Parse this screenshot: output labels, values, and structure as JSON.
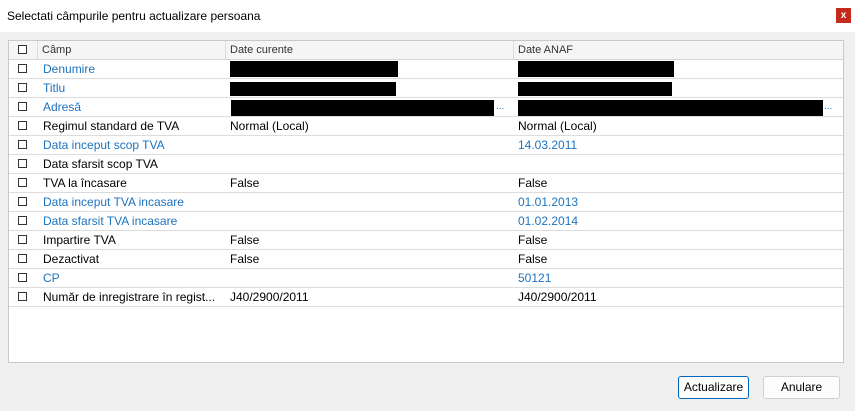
{
  "window": {
    "title": "Selectati câmpurile pentru actualizare persoana",
    "close_label": "x"
  },
  "grid": {
    "columns": [
      "Câmp",
      "Date curente",
      "Date ANAF"
    ],
    "rows": [
      {
        "field": "Denumire",
        "current": "",
        "anaf": "",
        "highlight": true
      },
      {
        "field": "Titlu",
        "current": "",
        "anaf": "",
        "highlight": true
      },
      {
        "field": "Adresă",
        "current": "",
        "anaf": "",
        "highlight": true
      },
      {
        "field": "Regimul standard de TVA",
        "current": "Normal (Local)",
        "anaf": "Normal (Local)",
        "highlight": false
      },
      {
        "field": "Data inceput scop TVA",
        "current": "",
        "anaf": "14.03.2011",
        "highlight": true
      },
      {
        "field": "Data sfarsit scop TVA",
        "current": "",
        "anaf": "",
        "highlight": false
      },
      {
        "field": "TVA la încasare",
        "current": "False",
        "anaf": "False",
        "highlight": false
      },
      {
        "field": "Data inceput TVA incasare",
        "current": "",
        "anaf": "01.01.2013",
        "highlight": true
      },
      {
        "field": "Data sfarsit TVA incasare",
        "current": "",
        "anaf": "01.02.2014",
        "highlight": true
      },
      {
        "field": "Impartire TVA",
        "current": "False",
        "anaf": "False",
        "highlight": false
      },
      {
        "field": "Dezactivat",
        "current": "False",
        "anaf": "False",
        "highlight": false
      },
      {
        "field": "CP",
        "current": "",
        "anaf": "50121",
        "highlight": true
      },
      {
        "field": "Număr de inregistrare în regist...",
        "current": "J40/2900/2011",
        "anaf": "J40/2900/2011",
        "highlight": false
      }
    ]
  },
  "buttons": {
    "update": "Actualizare",
    "cancel": "Anulare"
  },
  "colors": {
    "link": "#1e73be",
    "close_bg": "#c42b1c",
    "primary_border": "#0067c0"
  }
}
